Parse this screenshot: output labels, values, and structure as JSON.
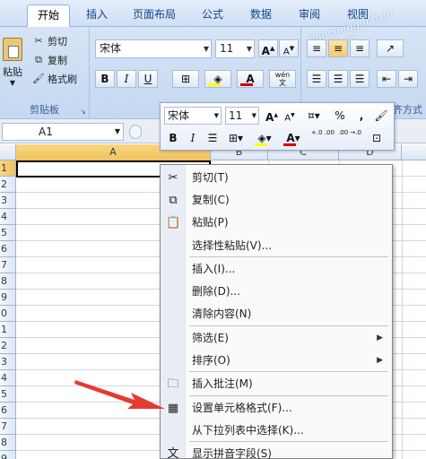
{
  "tabs": [
    "开始",
    "插入",
    "页面布局",
    "公式",
    "数据",
    "审阅",
    "视图"
  ],
  "watermark": [
    "jiaocheng.lchzju",
    "教程之家"
  ],
  "clipboard": {
    "paste_label": "粘贴",
    "cut_label": "剪切",
    "copy_label": "复制",
    "format_painter_label": "格式刷",
    "group_label": "剪贴板"
  },
  "font": {
    "name": "宋体",
    "size": "11",
    "grow_label": "A",
    "shrink_label": "A",
    "bold": "B",
    "italic": "I",
    "underline": "U",
    "font_color": "A",
    "phonetic_label": "wén"
  },
  "alignment": {
    "group_label_partial": "对齐方式"
  },
  "mini_toolbar": {
    "font_name": "宋体",
    "font_size": "11",
    "percent": "%",
    "comma": ",",
    "bold": "B",
    "italic": "I",
    "font_color": "A",
    "inc_decimal": "+.0 .00",
    "dec_decimal": ".00 →.0"
  },
  "name_box": "A1",
  "columns": [
    "A",
    "B",
    "C",
    "D"
  ],
  "rows": [
    "1",
    "2",
    "3",
    "4",
    "5",
    "6",
    "7",
    "8",
    "9",
    "0",
    "1",
    "2",
    "3",
    "4",
    "5",
    "6",
    "7",
    "8",
    "9"
  ],
  "context_menu": {
    "items": [
      {
        "label": "剪切(T)",
        "icon": "scissors-icon"
      },
      {
        "label": "复制(C)",
        "icon": "copy-icon"
      },
      {
        "label": "粘贴(P)",
        "icon": "paste-icon"
      },
      {
        "label": "选择性粘贴(V)...",
        "icon": ""
      },
      {
        "label": "插入(I)...",
        "icon": ""
      },
      {
        "label": "删除(D)...",
        "icon": ""
      },
      {
        "label": "清除内容(N)",
        "icon": ""
      },
      {
        "label": "筛选(E)",
        "icon": "",
        "submenu": "▶"
      },
      {
        "label": "排序(O)",
        "icon": "",
        "submenu": "▶"
      },
      {
        "label": "插入批注(M)",
        "icon": "comment-icon"
      },
      {
        "label": "设置单元格格式(F)...",
        "icon": "format-cells-icon"
      },
      {
        "label": "从下拉列表中选择(K)...",
        "icon": ""
      },
      {
        "label": "显示拼音字段(S)",
        "icon": "phonetic-icon"
      }
    ]
  },
  "colors": {
    "ribbon_bg": "#c5d9f1",
    "selection_header": "#f1c15f",
    "arrow": "#e53b2e",
    "font_color_swatch": "#d40000",
    "highlight_swatch": "#ffff00"
  }
}
